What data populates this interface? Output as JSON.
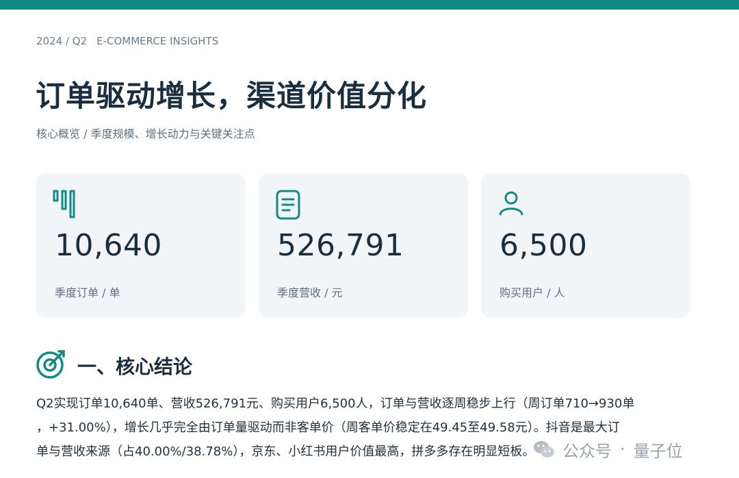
{
  "header": {
    "period": "2024 / Q2",
    "section_tag": "E-COMMERCE INSIGHTS",
    "title": "订单驱动增长，渠道价值分化",
    "subtitle": "核心概览 / 季度规模、增长动力与关键关注点"
  },
  "kpis": [
    {
      "icon": "bar-chart-icon",
      "value": "10,640",
      "label": "季度订单 / 单"
    },
    {
      "icon": "document-icon",
      "value": "526,791",
      "label": "季度营收 / 元"
    },
    {
      "icon": "user-icon",
      "value": "6,500",
      "label": "购买用户 / 人"
    }
  ],
  "section": {
    "icon": "target-icon",
    "title": "一、核心结论",
    "paragraph_lines": [
      "Q2实现订单10,640单、营收526,791元、购买用户6,500人，订单与营收逐周稳步上行（周订单710→930单",
      "，+31.00%），增长几乎完全由订单量驱动而非客单价（周客单价稳定在49.45至49.58元）。抖音是最大订",
      "单与营收来源（占40.00%/38.78%），京东、小红书用户价值最高，拼多多存在明显短板。"
    ]
  },
  "watermark": {
    "icon": "wechat-icon",
    "left_text": "公众号",
    "separator": "·",
    "right_text": "量子位"
  },
  "colors": {
    "accent": "#0f8a84",
    "heading": "#1a2e40",
    "muted": "#5f6f7f",
    "card_bg": "#f2f5f8"
  }
}
